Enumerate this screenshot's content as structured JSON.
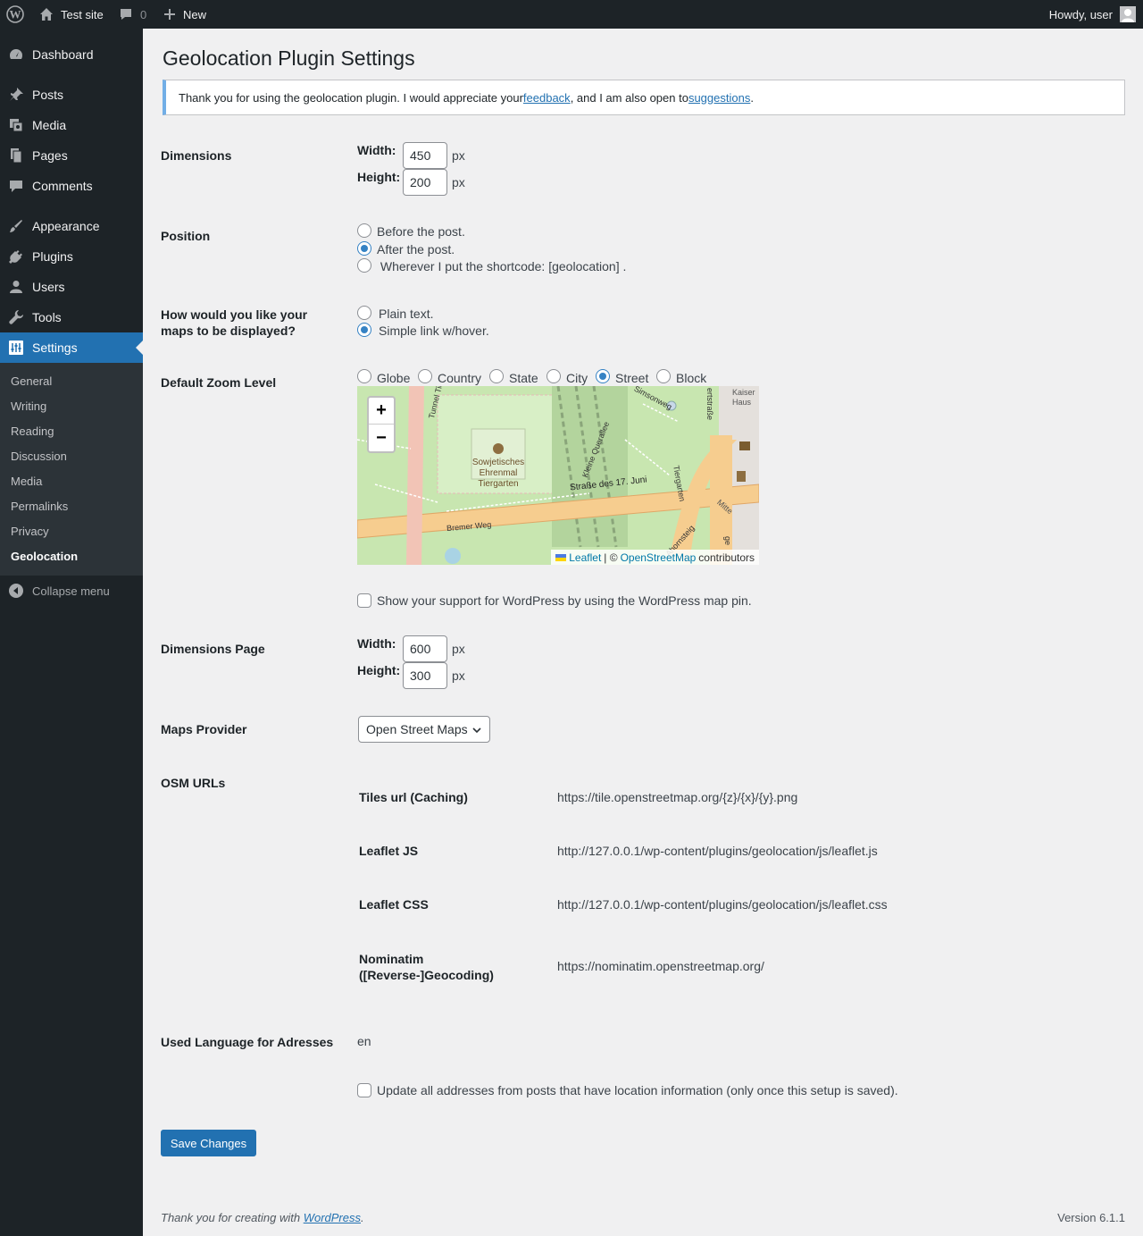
{
  "adminbar": {
    "site_name": "Test site",
    "comments_count": "0",
    "new_label": "New",
    "greeting": "Howdy, user"
  },
  "sidebar": {
    "items": [
      {
        "label": "Dashboard",
        "icon": "dashboard-icon"
      },
      {
        "label": "Posts",
        "icon": "pin-icon"
      },
      {
        "label": "Media",
        "icon": "media-icon"
      },
      {
        "label": "Pages",
        "icon": "pages-icon"
      },
      {
        "label": "Comments",
        "icon": "comments-icon"
      },
      {
        "label": "Appearance",
        "icon": "brush-icon"
      },
      {
        "label": "Plugins",
        "icon": "plug-icon"
      },
      {
        "label": "Users",
        "icon": "user-icon"
      },
      {
        "label": "Tools",
        "icon": "wrench-icon"
      },
      {
        "label": "Settings",
        "icon": "settings-icon"
      }
    ],
    "submenu": [
      "General",
      "Writing",
      "Reading",
      "Discussion",
      "Media",
      "Permalinks",
      "Privacy",
      "Geolocation"
    ],
    "collapse_label": "Collapse menu"
  },
  "page": {
    "title": "Geolocation Plugin Settings",
    "notice": {
      "before": "Thank you for using the geolocation plugin. I would appreciate your ",
      "link1": "feedback",
      "middle": ", and I am also open to ",
      "link2": "suggestions",
      "after": "."
    },
    "dimensions": {
      "label": "Dimensions",
      "width_label": "Width:",
      "height_label": "Height:",
      "width": "450",
      "height": "200",
      "unit": "px"
    },
    "position": {
      "label": "Position",
      "options": [
        "Before the post.",
        "After the post.",
        " Wherever I put the shortcode: [geolocation] ."
      ],
      "selected": 1
    },
    "display": {
      "label": "How would you like your maps to be displayed?",
      "options": [
        "Plain text.",
        "Simple link w/hover."
      ],
      "selected": 1
    },
    "zoom": {
      "label": "Default Zoom Level",
      "options": [
        "Globe",
        "Country",
        "State",
        "City",
        "Street",
        "Block"
      ],
      "selected": 4
    },
    "map": {
      "zoom_in": "+",
      "zoom_out": "−",
      "labels": {
        "tunnel": "Tunnel Tiergarten",
        "monument": "Sowjetisches Ehrenmal Tiergarten",
        "street": "Straße des 17. Juni",
        "bremer": "Bremer Weg",
        "simsonweg": "Simsonweg",
        "querallee": "Kleine Querallee",
        "tiergarten": "Tiergarten",
        "mitte": "Mitte",
        "ahornsteig": "Ahornsteig",
        "strasse": "ertstraße",
        "kaiser": "Kaiser Haus",
        "ge": "ge"
      },
      "attribution": {
        "leaflet": "Leaflet",
        "sep": "| ©",
        "osm": "OpenStreetMap",
        "contributors": "contributors"
      }
    },
    "support_pin": "Show your support for WordPress by using the WordPress map pin.",
    "dimensions_page": {
      "label": "Dimensions Page",
      "width_label": "Width:",
      "height_label": "Height:",
      "width": "600",
      "height": "300",
      "unit": "px"
    },
    "provider": {
      "label": "Maps Provider",
      "selected": "Open Street Maps"
    },
    "osm_urls": {
      "label": "OSM URLs",
      "rows": [
        {
          "name": "Tiles url (Caching)",
          "value": "https://tile.openstreetmap.org/{z}/{x}/{y}.png"
        },
        {
          "name": "Leaflet JS",
          "value": "http://127.0.0.1/wp-content/plugins/geolocation/js/leaflet.js"
        },
        {
          "name": "Leaflet CSS",
          "value": "http://127.0.0.1/wp-content/plugins/geolocation/js/leaflet.css"
        },
        {
          "name": "Nominatim ([Reverse-]Geocoding)",
          "value": "https://nominatim.openstreetmap.org/"
        }
      ]
    },
    "language": {
      "label": "Used Language for Adresses",
      "value": "en"
    },
    "update_addresses": "Update all addresses from posts that have location information (only once this setup is saved).",
    "save_label": "Save Changes"
  },
  "footer": {
    "thanks_before": "Thank you for creating with ",
    "thanks_link": "WordPress",
    "thanks_after": ".",
    "version": "Version 6.1.1"
  },
  "colors": {
    "admin_bg": "#1d2327",
    "accent": "#2271b1",
    "notice_border": "#72aee6"
  }
}
